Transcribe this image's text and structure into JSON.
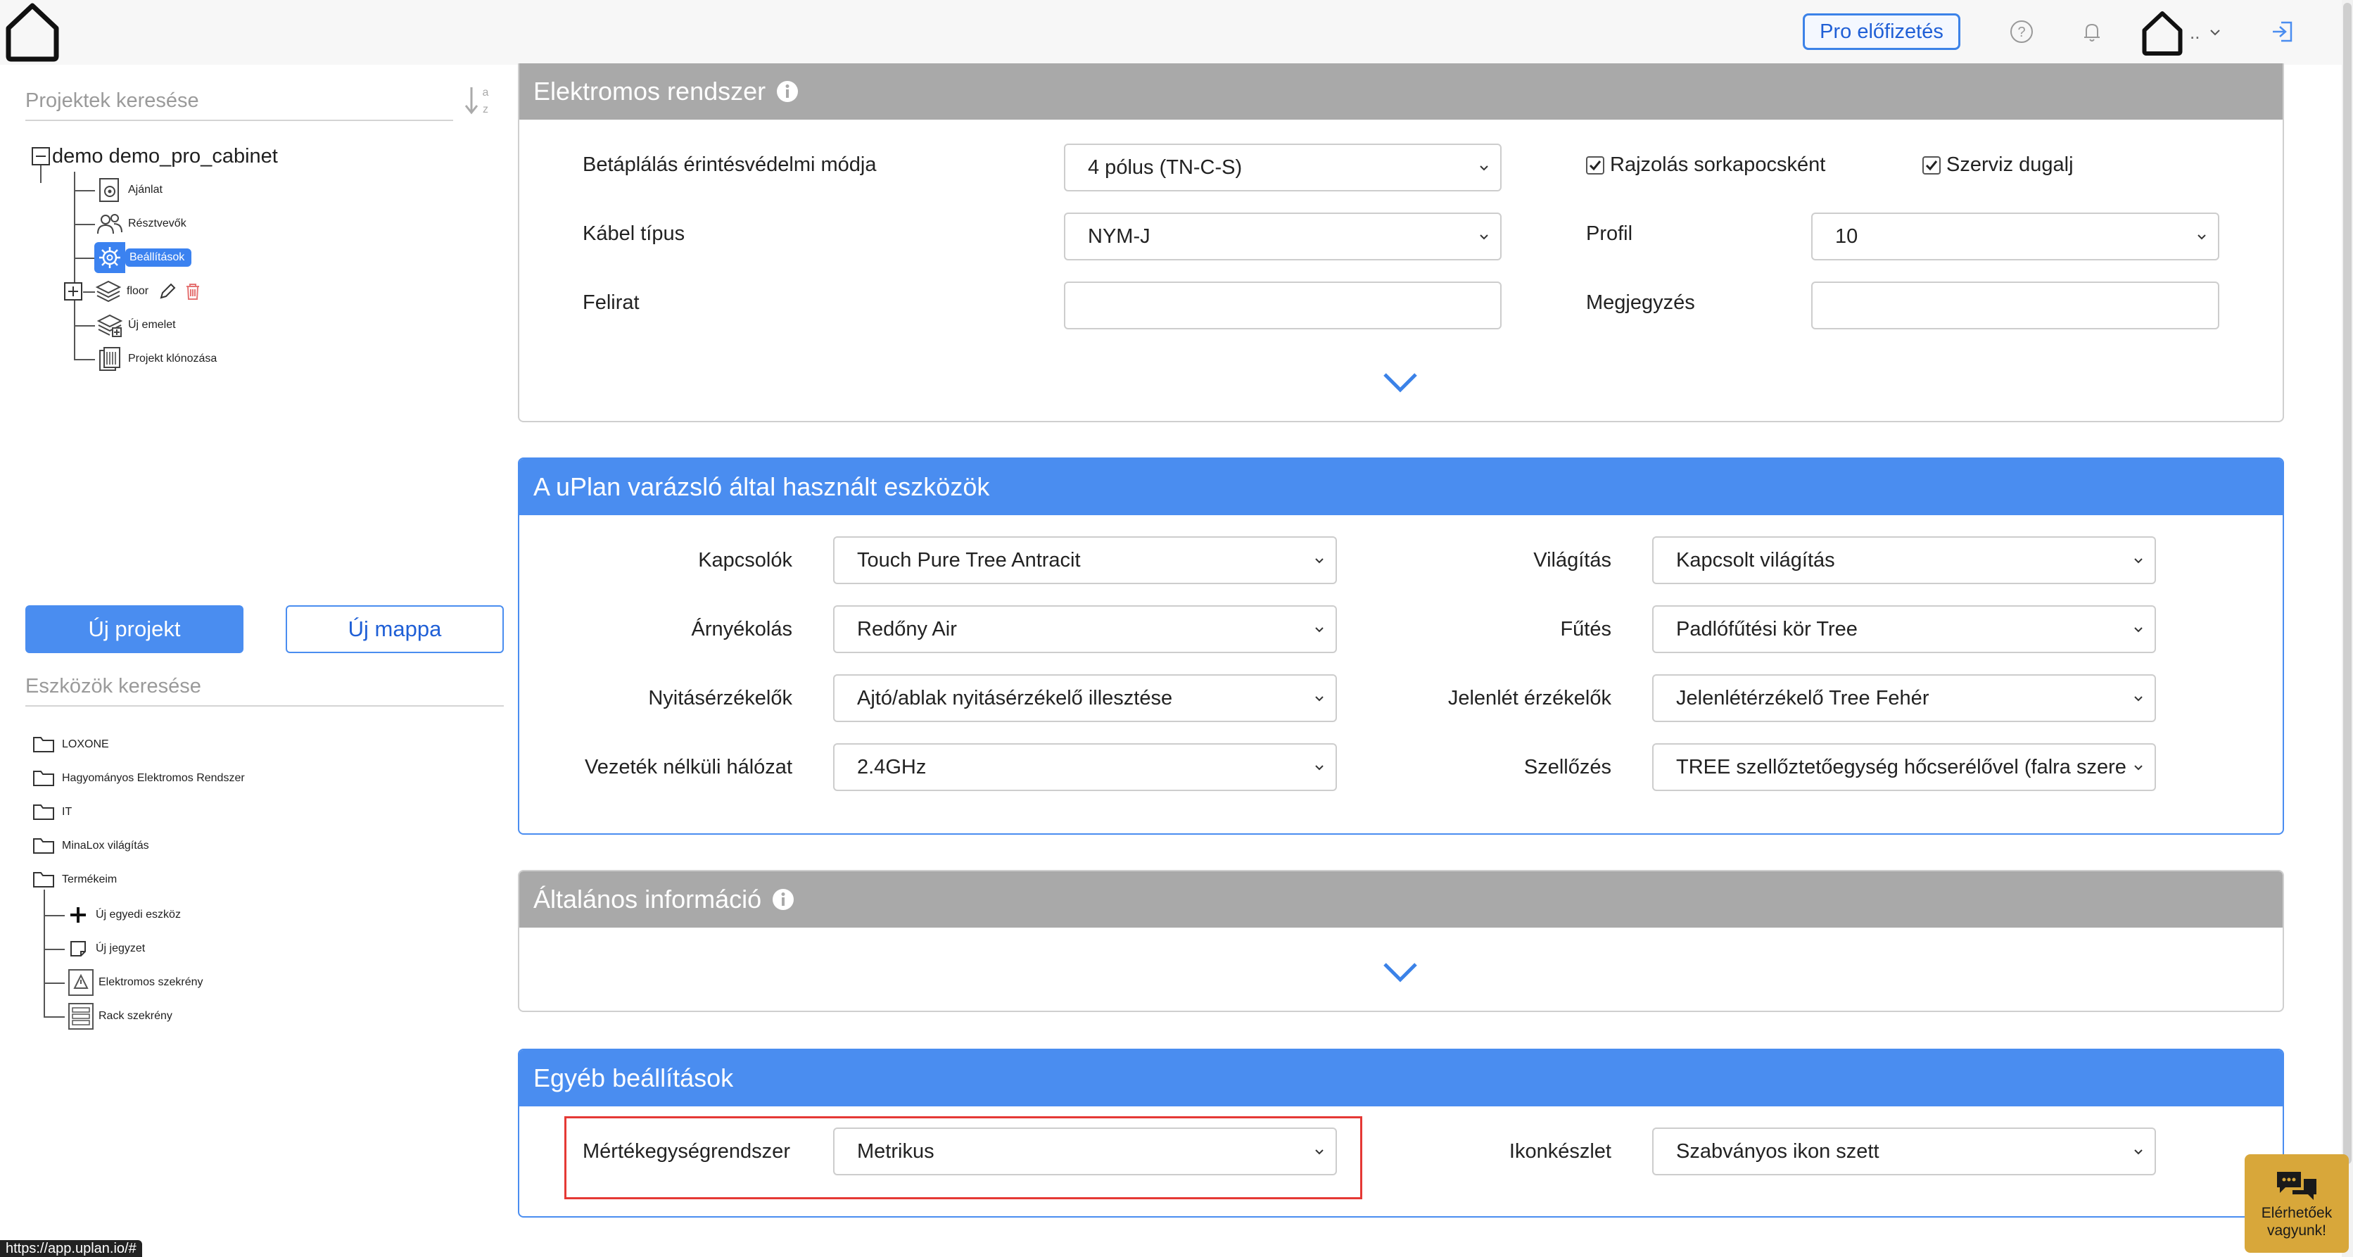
{
  "topbar": {
    "pro_button": "Pro előfizetés",
    "user_dots": ".."
  },
  "sidebar": {
    "project_search_placeholder": "Projektek keresése",
    "project_tree": {
      "root": "demo demo_pro_cabinet",
      "items": [
        {
          "label": "Ajánlat",
          "icon": "quote-gear-icon"
        },
        {
          "label": "Résztvevők",
          "icon": "participants-icon"
        },
        {
          "label": "Beállítások",
          "icon": "settings-gear-icon",
          "selected": true
        },
        {
          "label": "floor",
          "icon": "layers-icon"
        },
        {
          "label": "Új emelet",
          "icon": "new-floor-icon"
        },
        {
          "label": "Projekt klónozása",
          "icon": "clone-icon"
        }
      ]
    },
    "new_project_button": "Új projekt",
    "new_folder_button": "Új mappa",
    "tool_search_placeholder": "Eszközök keresése",
    "tool_tree": [
      {
        "label": "LOXONE"
      },
      {
        "label": "Hagyományos Elektromos Rendszer"
      },
      {
        "label": "IT"
      },
      {
        "label": "MinaLox világítás"
      },
      {
        "label": "Termékeim"
      }
    ],
    "termekeim_children": [
      {
        "label": "Új egyedi eszköz",
        "icon": "plus-icon"
      },
      {
        "label": "Új jegyzet",
        "icon": "note-icon"
      },
      {
        "label": "Elektromos szekrény",
        "icon": "electrical-cabinet-icon"
      },
      {
        "label": "Rack szekrény",
        "icon": "rack-cabinet-icon"
      }
    ]
  },
  "panels": {
    "electrical": {
      "title": "Elektromos rendszer",
      "supply_label": "Betáplálás érintésvédelmi módja",
      "supply_value": "4 pólus (TN-C-S)",
      "cable_label": "Kábel típus",
      "cable_value": "NYM-J",
      "caption_label": "Felirat",
      "caption_value": "",
      "draw_terminal_label": "Rajzolás sorkapocsként",
      "draw_terminal_checked": true,
      "service_socket_label": "Szerviz dugalj",
      "service_socket_checked": true,
      "profile_label": "Profil",
      "profile_value": "10",
      "note_label": "Megjegyzés",
      "note_value": ""
    },
    "wizard": {
      "title": "A uPlan varázsló által használt eszközök",
      "switches_label": "Kapcsolók",
      "switches_value": "Touch Pure Tree Antracit",
      "shading_label": "Árnyékolás",
      "shading_value": "Redőny Air",
      "opening_label": "Nyitásérzékelők",
      "opening_value": "Ajtó/ablak nyitásérzékelő illesztése",
      "wireless_label": "Vezeték nélküli hálózat",
      "wireless_value": "2.4GHz",
      "lighting_label": "Világítás",
      "lighting_value": "Kapcsolt világítás",
      "heating_label": "Fűtés",
      "heating_value": "Padlófűtési kör Tree",
      "presence_label": "Jelenlét érzékelők",
      "presence_value": "Jelenlétérzékelő Tree Fehér",
      "ventilation_label": "Szellőzés",
      "ventilation_value": "TREE szellőztetőegység hőcserélővel (falra szere"
    },
    "general": {
      "title": "Általános információ"
    },
    "other": {
      "title": "Egyéb beállítások",
      "units_label": "Mértékegységrendszer",
      "units_value": "Metrikus",
      "iconset_label": "Ikonkészlet",
      "iconset_value": "Szabványos ikon szett"
    }
  },
  "status_url": "https://app.uplan.io/#",
  "chat_widget": {
    "line1": "Elérhetőek",
    "line2": "vagyunk!"
  },
  "colors": {
    "accent": "#4a8df0",
    "panel_gray": "#a9a9a9",
    "highlight_red": "#e53935",
    "chat_bg": "#d8a73a"
  }
}
